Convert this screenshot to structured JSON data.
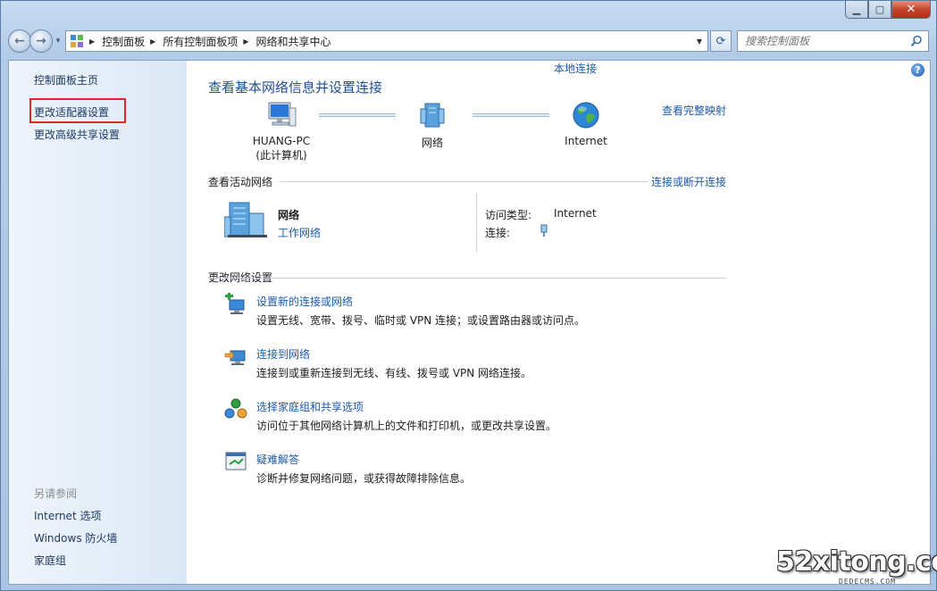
{
  "window": {
    "minimize_icon": "minimize-icon",
    "maximize_icon": "maximize-icon",
    "close_icon": "close-icon"
  },
  "nav": {
    "breadcrumbs": [
      "控制面板",
      "所有控制面板项",
      "网络和共享中心"
    ],
    "search_placeholder": "搜索控制面板"
  },
  "sidebar": {
    "links": [
      "控制面板主页",
      "更改适配器设置",
      "更改高级共享设置"
    ],
    "see_also_title": "另请参阅",
    "see_also": [
      "Internet 选项",
      "Windows 防火墙",
      "家庭组"
    ],
    "highlight_color": "#e0262a"
  },
  "main": {
    "title": "查看基本网络信息并设置连接",
    "view_full_map": "查看完整映射",
    "map": {
      "computer_name": "HUANG-PC",
      "computer_sub": "(此计算机)",
      "network": "网络",
      "internet": "Internet"
    },
    "active": {
      "heading": "查看活动网络",
      "connect_link": "连接或断开连接",
      "network_name": "网络",
      "network_type": "工作网络",
      "access_type_label": "访问类型:",
      "access_type_value": "Internet",
      "connection_label": "连接:",
      "connection_value": "本地连接"
    },
    "change": {
      "heading": "更改网络设置",
      "tasks": [
        {
          "title": "设置新的连接或网络",
          "desc": "设置无线、宽带、拨号、临时或 VPN 连接；或设置路由器或访问点。",
          "icon": "new-connection-icon"
        },
        {
          "title": "连接到网络",
          "desc": "连接到或重新连接到无线、有线、拨号或 VPN 网络连接。",
          "icon": "connect-network-icon"
        },
        {
          "title": "选择家庭组和共享选项",
          "desc": "访问位于其他网络计算机上的文件和打印机，或更改共享设置。",
          "icon": "homegroup-icon"
        },
        {
          "title": "疑难解答",
          "desc": "诊断并修复网络问题，或获得故障排除信息。",
          "icon": "troubleshoot-icon"
        }
      ]
    }
  },
  "watermark": {
    "text": "52xitong.com",
    "sub": "DEDECMS.COM"
  },
  "colors": {
    "link": "#1e5aa8",
    "title": "#1e4f99",
    "sidebar_bg": "#dce8f6"
  }
}
